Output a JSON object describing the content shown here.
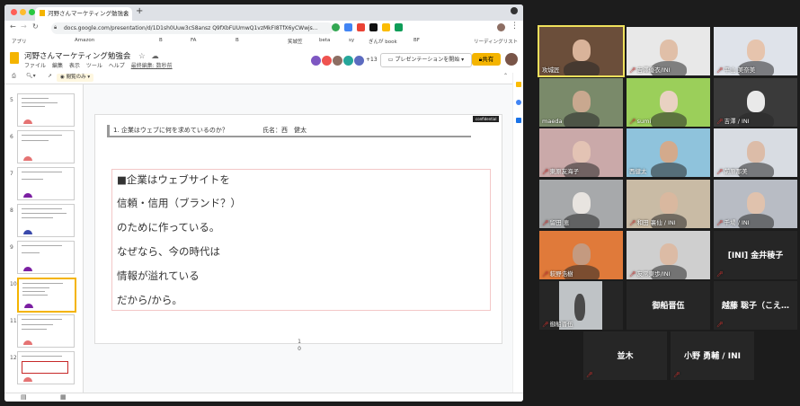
{
  "browser": {
    "tab_title": "河野さんマーケティング勉強会",
    "url": "docs.google.com/presentation/d/1D1sh0Uuw3cS8ansz Q9fXbFUUmwQ1vzMkFI8TfX6yCWwjs...",
    "bookmarks": [
      "アプリ",
      "Amazon",
      "B",
      "FA",
      "B",
      "笑城笠",
      "beta",
      "sy",
      "ぎんが book",
      "BF",
      "リーディングリスト"
    ]
  },
  "app": {
    "doc_title": "河野さんマーケティング勉強会",
    "menus": [
      "ファイル",
      "編集",
      "表示",
      "ツール",
      "ヘルプ"
    ],
    "last_edit": "最終編集: 数秒前",
    "collaborators_extra": "+13",
    "present_label": "プレゼンテーションを開始",
    "share_label": "共有",
    "view_only_label": "閲覧のみ"
  },
  "filmstrip": {
    "slides": [
      {
        "num": "5",
        "selected": false,
        "mark_color": "#e57373"
      },
      {
        "num": "6",
        "selected": false,
        "mark_color": "#e57373"
      },
      {
        "num": "7",
        "selected": false,
        "mark_color": "#7b1fa2"
      },
      {
        "num": "8",
        "selected": false,
        "mark_color": "#3949ab"
      },
      {
        "num": "9",
        "selected": false,
        "mark_color": "#7b1fa2"
      },
      {
        "num": "10",
        "selected": true,
        "mark_color": "#7b1fa2"
      },
      {
        "num": "11",
        "selected": false,
        "mark_color": "#e57373"
      },
      {
        "num": "12",
        "selected": false,
        "mark_color": "#e57373"
      }
    ]
  },
  "slide": {
    "confidential": "confidential",
    "question": "1. 企業はウェブに何を求めているのか？",
    "author": "氏名：西　健太",
    "lines": [
      "■企業はウェブサイトを",
      "信頼・信用（ブランド？）",
      "のために作っている。",
      "なぜなら、今の時代は",
      "情報が溢れている",
      "だから/から。"
    ],
    "page_indicator_top": "1",
    "page_indicator_bottom": "0"
  },
  "participants": [
    {
      "name": "攻城匠",
      "muted": false,
      "kind": "video",
      "bg": "#6b4e3a",
      "face": "#d9b39a",
      "active": true
    },
    {
      "name": "吉澤優衣/INI",
      "muted": true,
      "kind": "video",
      "bg": "#e8e8e8",
      "face": "#e0bfa8"
    },
    {
      "name": "平山 美奈美",
      "muted": true,
      "kind": "video",
      "bg": "#dfe3ea",
      "face": "#e6c4ad"
    },
    {
      "name": "maeda",
      "muted": false,
      "kind": "video",
      "bg": "#7a8a6a",
      "face": "#c9a88f"
    },
    {
      "name": "sumi",
      "muted": true,
      "kind": "video",
      "bg": "#9bcf5a",
      "face": "#e9d2c2"
    },
    {
      "name": "吉澤 / INI",
      "muted": true,
      "kind": "video",
      "bg": "#3a3a3a",
      "face": "#e9e9e9"
    },
    {
      "name": "東原友海子",
      "muted": true,
      "kind": "video",
      "bg": "#caa9a9",
      "face": "#e3c3b4"
    },
    {
      "name": "西健太",
      "muted": false,
      "kind": "video",
      "bg": "#8fc3dc",
      "face": "#d3aa8c"
    },
    {
      "name": "前原那美",
      "muted": true,
      "kind": "video",
      "bg": "#d8dce2",
      "face": "#dcbca8"
    },
    {
      "name": "留田 恵",
      "muted": true,
      "kind": "video",
      "bg": "#a7a9ab",
      "face": "#e8e4e0"
    },
    {
      "name": "和田 裏仙 / INI",
      "muted": true,
      "kind": "video",
      "bg": "#c9bba5",
      "face": "#d9b89f"
    },
    {
      "name": "千場 / INI",
      "muted": true,
      "kind": "video",
      "bg": "#b8bcc4",
      "face": "#e0c2ad"
    },
    {
      "name": "萩野浩樹",
      "muted": true,
      "kind": "video",
      "bg": "#e07a3a",
      "face": "#c49a80"
    },
    {
      "name": "友常東歩/INI",
      "muted": true,
      "kind": "video",
      "bg": "#cfcfcf",
      "face": "#dcbba5"
    },
    {
      "name": "[INI] 金井稜子",
      "muted": true,
      "kind": "name"
    },
    {
      "name": "御船晋伍",
      "muted": true,
      "kind": "video",
      "bg": "#bfc3c6",
      "face": "#4a4a4a"
    },
    {
      "name": "御船晋伍",
      "muted": false,
      "kind": "name"
    },
    {
      "name": "越藤 聡子（こえ…",
      "muted": true,
      "kind": "name"
    },
    {
      "name": "並木",
      "muted": true,
      "kind": "name"
    },
    {
      "name": "小野 勇輔 / INI",
      "muted": true,
      "kind": "name"
    }
  ]
}
